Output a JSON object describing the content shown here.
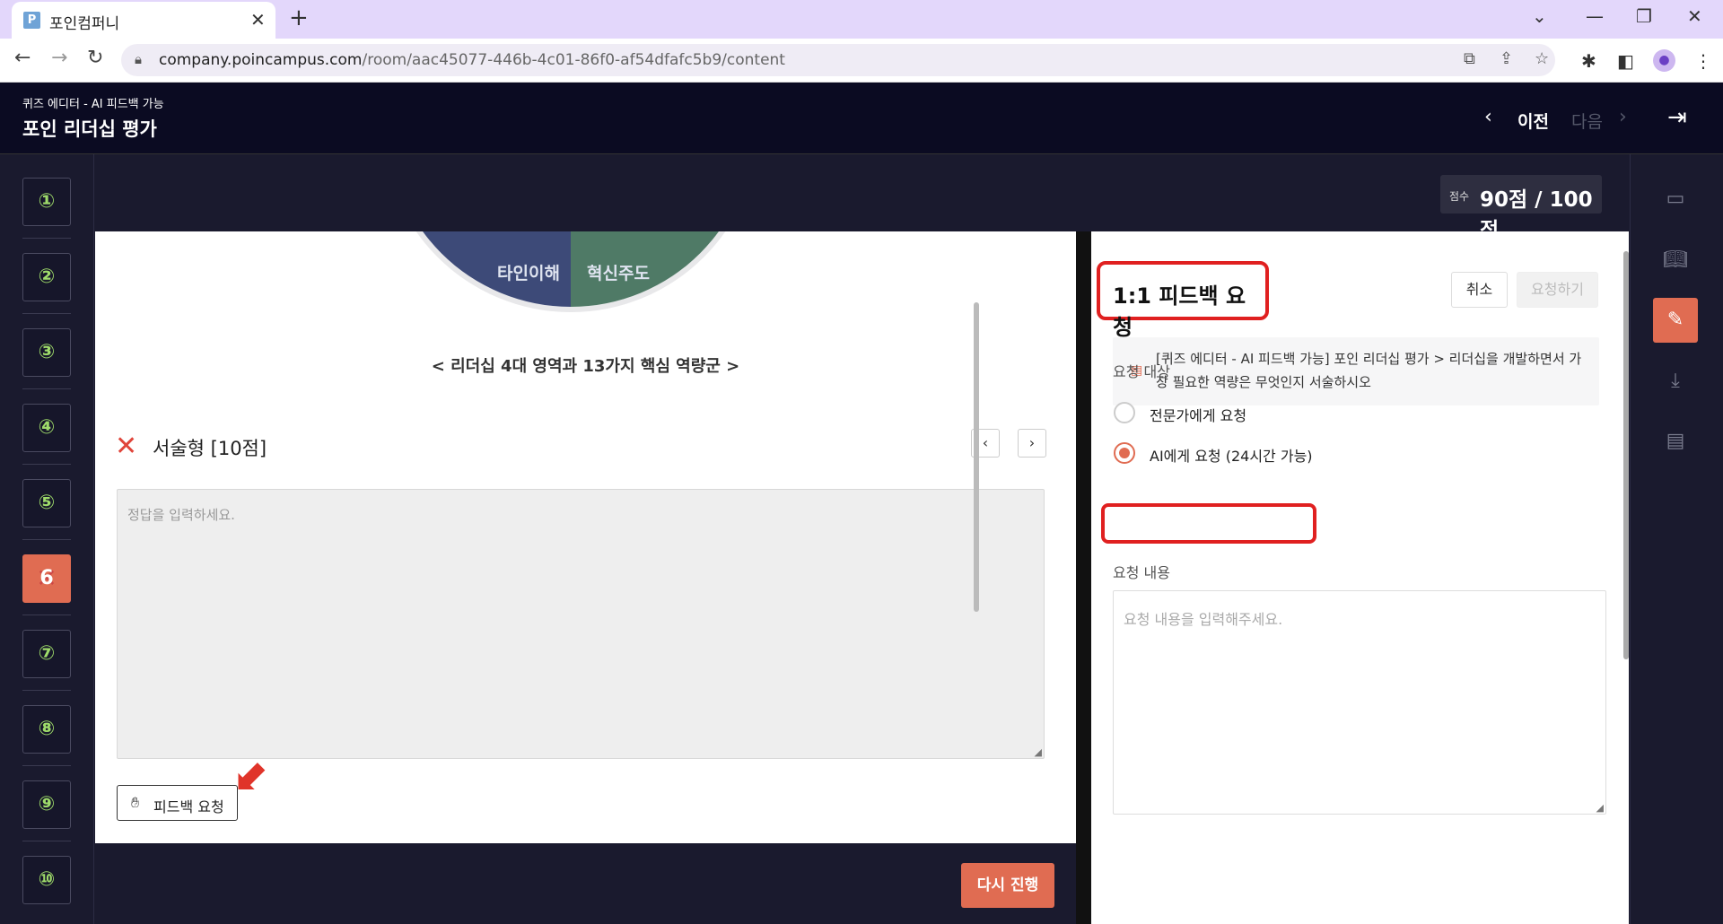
{
  "browser": {
    "tab_favicon": "P",
    "tab_title": "포인컴퍼니",
    "tab_close": "✕",
    "new_tab": "+",
    "url_host": "company.poincampus.com",
    "url_path": "/room/aac45077-446b-4c01-86f0-af54dfafc5b9/content"
  },
  "header": {
    "subtitle": "퀴즈 에디터 - AI 피드백 가능",
    "title": "포인 리더십 평가",
    "prev_label": "이전",
    "next_label": "다음"
  },
  "sidebar": {
    "questions": [
      {
        "label": "①"
      },
      {
        "label": "②"
      },
      {
        "label": "③"
      },
      {
        "label": "④"
      },
      {
        "label": "⑤"
      },
      {
        "label": "6"
      },
      {
        "label": "⑦"
      },
      {
        "label": "⑧"
      },
      {
        "label": "⑨"
      },
      {
        "label": "⑩"
      }
    ],
    "active_index": 6
  },
  "score": {
    "label": "점수",
    "value": "90점 / 100점"
  },
  "question": {
    "chart_labels": [
      "타인이해",
      "혁신주도"
    ],
    "caption": "< 리더십 4대 영역과 13가지 핵심 역량군 >",
    "type_label": "서술형 [10점]",
    "answer_placeholder": "정답을 입력하세요.",
    "feedback_button": "피드백 요청",
    "retry_button": "다시 진행"
  },
  "feedback_panel": {
    "title": "1:1 피드백 요청",
    "cancel": "취소",
    "submit": "요청하기",
    "context": "[퀴즈 에디터 - AI 피드백 가능] 포인 리더십 평가 > 리더십을 개발하면서 가장 필요한 역량은 무엇인지 서술하시오",
    "target_label": "요청 대상",
    "options": [
      {
        "label": "전문가에게 요청",
        "checked": false
      },
      {
        "label": "AI에게 요청 (24시간 가능)",
        "checked": true
      }
    ],
    "content_label": "요청 내용",
    "content_placeholder": "요청 내용을 입력해주세요."
  },
  "tools": [
    "monitor-icon",
    "book-icon",
    "feedback-request-icon",
    "download-icon",
    "chat-icon"
  ],
  "colors": {
    "accent": "#e06c52",
    "highlight_red": "#e02020",
    "dark_bg": "#1a1a2e",
    "header_bg": "#0b0b22",
    "question_number": "#9edb6a"
  }
}
